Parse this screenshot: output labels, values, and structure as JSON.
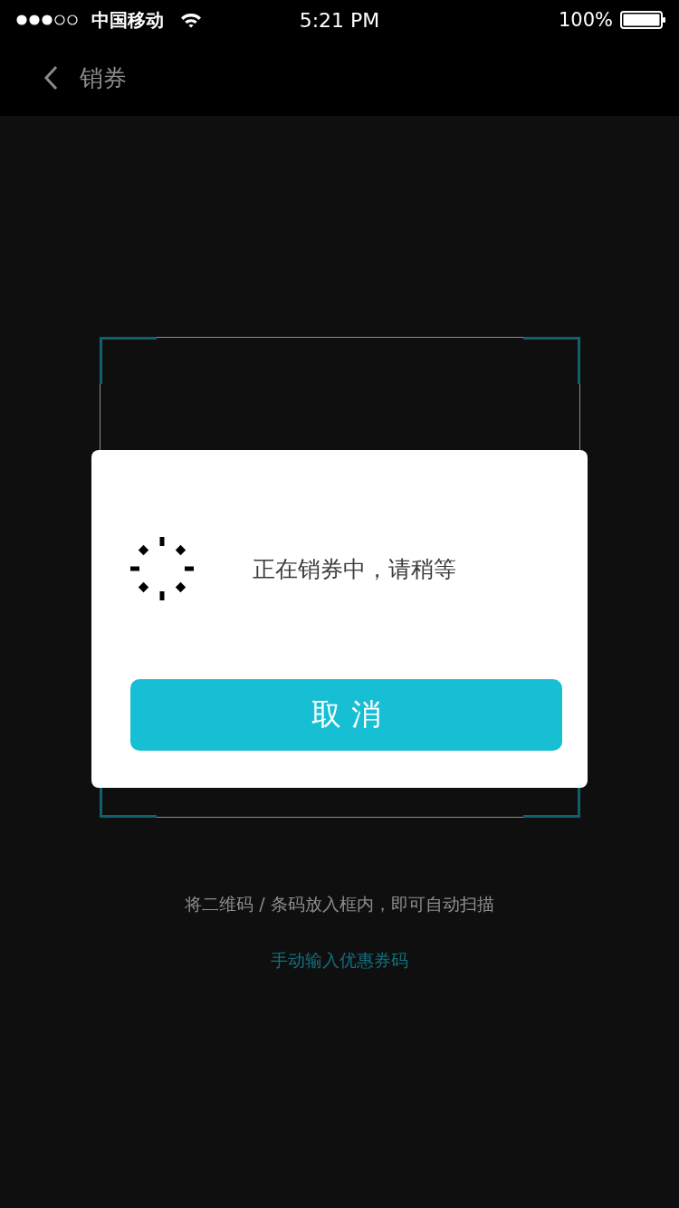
{
  "status_bar": {
    "carrier": "中国移动",
    "time": "5:21 PM",
    "battery": "100%"
  },
  "nav_bar": {
    "title": "销券"
  },
  "scanner": {
    "hint": "将二维码 / 条码放入框内，即可自动扫描",
    "manual_entry_link": "手动输入优惠券码"
  },
  "dialog": {
    "message": "正在销券中，请稍等",
    "cancel_button": {
      "label": "取 消"
    }
  }
}
